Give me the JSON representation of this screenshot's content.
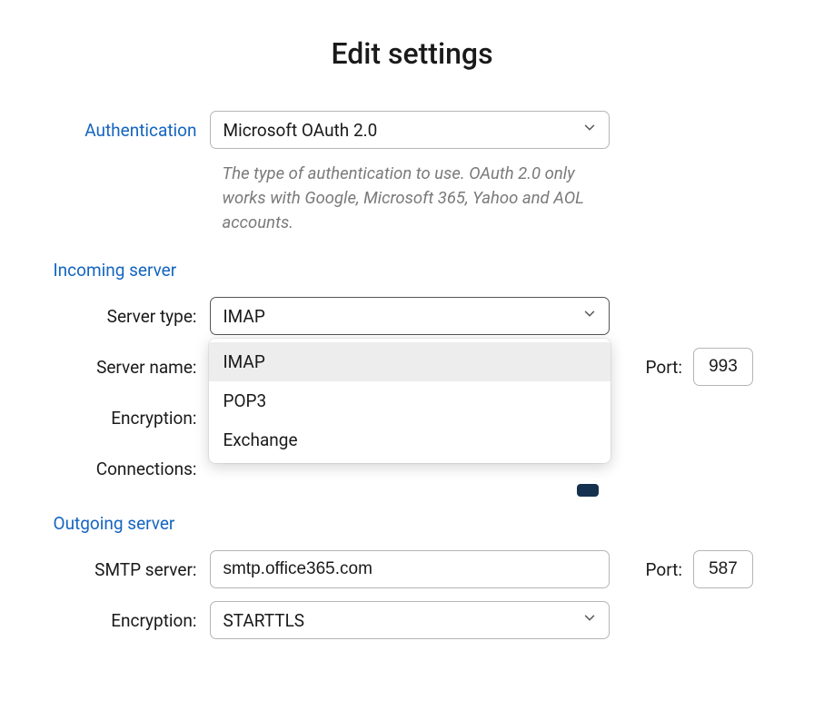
{
  "title": "Edit settings",
  "authentication": {
    "label": "Authentication",
    "value": "Microsoft OAuth 2.0",
    "helper": "The type of authentication to use. OAuth 2.0 only works with Google, Microsoft 365, Yahoo and AOL accounts."
  },
  "incoming": {
    "header": "Incoming server",
    "server_type": {
      "label": "Server type:",
      "value": "IMAP",
      "options": [
        "IMAP",
        "POP3",
        "Exchange"
      ],
      "highlighted_index": 0
    },
    "server_name": {
      "label": "Server name:",
      "value": ""
    },
    "port": {
      "label": "Port:",
      "value": "993"
    },
    "encryption": {
      "label": "Encryption:",
      "value": ""
    },
    "connections": {
      "label": "Connections:",
      "value": ""
    }
  },
  "outgoing": {
    "header": "Outgoing server",
    "smtp_server": {
      "label": "SMTP server:",
      "value": "smtp.office365.com"
    },
    "port": {
      "label": "Port:",
      "value": "587"
    },
    "encryption": {
      "label": "Encryption:",
      "value": "STARTTLS"
    }
  }
}
